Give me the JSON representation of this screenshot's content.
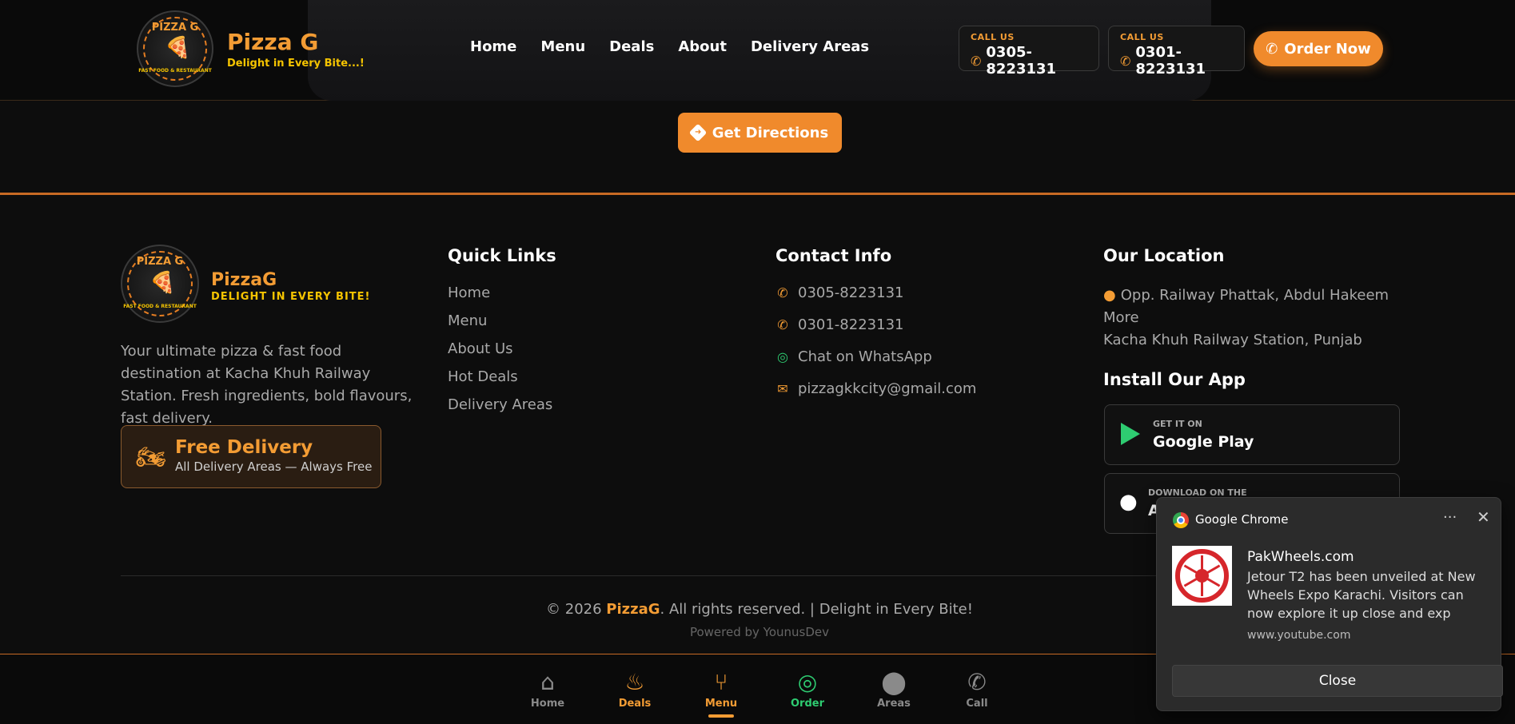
{
  "header": {
    "logo_ring_text": "PIZZA G",
    "logo_sub_text": "FAST FOOD & RESTAURANT",
    "brand": "Pizza G",
    "tagline": "Delight in Every Bite...!",
    "nav": [
      "Home",
      "Menu",
      "Deals",
      "About",
      "Delivery Areas"
    ],
    "calls": [
      {
        "label": "CALL US",
        "number": "0305-8223131"
      },
      {
        "label": "CALL US",
        "number": "0301-8223131"
      }
    ],
    "order_button": "Order Now"
  },
  "directions_button": "Get Directions",
  "footer": {
    "brand": "PizzaG",
    "tagline": "DELIGHT IN EVERY BITE!",
    "description": "Your ultimate pizza & fast food destination at Kacha Khuh Railway Station. Fresh ingredients, bold flavours, fast delivery.",
    "free_delivery_title": "Free Delivery",
    "free_delivery_sub": "All Delivery Areas — Always Free",
    "quick_links_title": "Quick Links",
    "quick_links": [
      "Home",
      "Menu",
      "About Us",
      "Hot Deals",
      "Delivery Areas"
    ],
    "contact_title": "Contact Info",
    "contact": {
      "phone1": "0305-8223131",
      "phone2": "0301-8223131",
      "whatsapp": "Chat on WhatsApp",
      "email": "pizzagkkcity@gmail.com"
    },
    "location_title": "Our Location",
    "location_line1": "Opp. Railway Phattak, Abdul Hakeem More",
    "location_line2": "Kacha Khuh Railway Station, Punjab",
    "app_title": "Install Our App",
    "google_play": {
      "small": "GET IT ON",
      "big": "Google Play"
    },
    "app_store": {
      "small": "DOWNLOAD ON THE",
      "big": "A"
    },
    "copyright_prefix": "© 2026 ",
    "copyright_brand": "PizzaG",
    "copyright_suffix": ". All rights reserved. | Delight in Every Bite!",
    "powered_by": "Powered by YounusDev"
  },
  "bottom_nav": [
    {
      "label": "Home",
      "icon": "home-icon",
      "color": "#8a8a8a"
    },
    {
      "label": "Deals",
      "icon": "fire-icon",
      "color": "#f39c34"
    },
    {
      "label": "Menu",
      "icon": "utensils-icon",
      "color": "#f39c34"
    },
    {
      "label": "Order",
      "icon": "whatsapp-icon",
      "color": "#2ecc71"
    },
    {
      "label": "Areas",
      "icon": "map-pin-icon",
      "color": "#8a8a8a"
    },
    {
      "label": "Call",
      "icon": "phone-icon",
      "color": "#8a8a8a"
    }
  ],
  "notification": {
    "app": "Google Chrome",
    "title": "PakWheels.com",
    "body": "Jetour T2 has been unveiled at New Wheels Expo Karachi. Visitors can now explore it up close and exp",
    "source": "www.youtube.com",
    "close_button": "Close"
  },
  "colors": {
    "accent": "#f08a2c",
    "tagline": "#f5c400",
    "whatsapp": "#2ecc71"
  }
}
